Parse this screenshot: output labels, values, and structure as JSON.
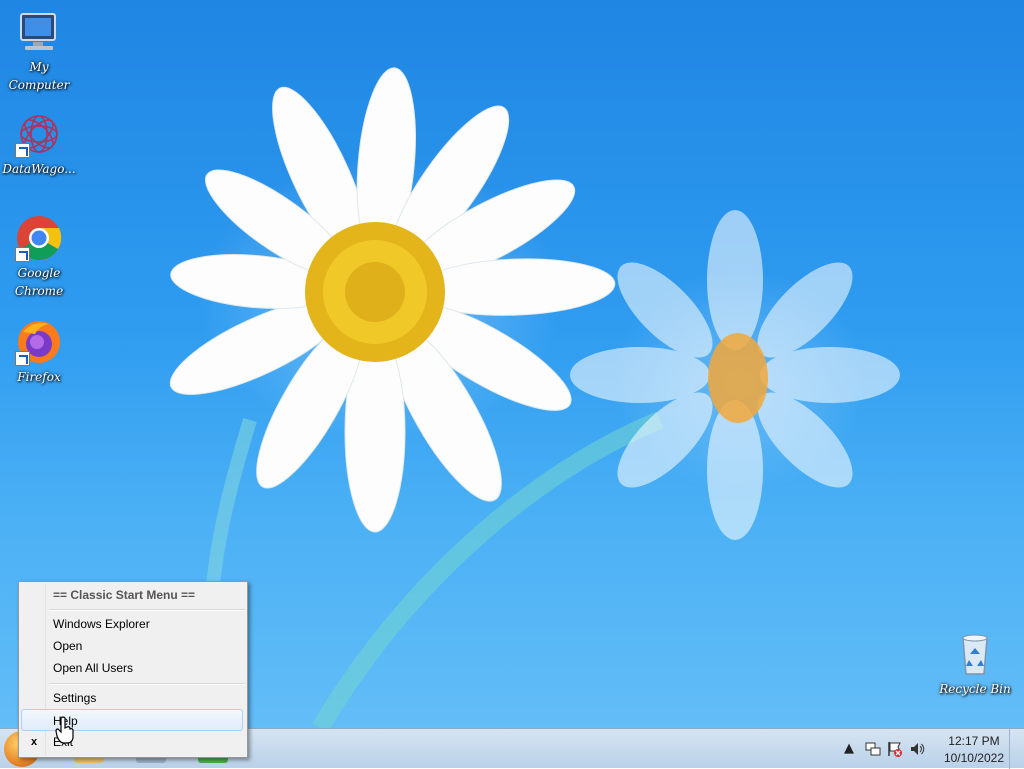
{
  "desktop": {
    "icons": [
      {
        "label": "My Computer",
        "icon": "computer-icon"
      },
      {
        "label": "DataWago...",
        "icon": "datawago-icon"
      },
      {
        "label": "Google Chrome",
        "icon": "chrome-icon"
      },
      {
        "label": "Firefox",
        "icon": "firefox-icon"
      },
      {
        "label": "Recycle Bin",
        "icon": "recycle-bin-icon"
      }
    ]
  },
  "context_menu": {
    "header": "== Classic Start Menu ==",
    "items": [
      {
        "label": "Windows Explorer"
      },
      {
        "label": "Open"
      },
      {
        "label": "Open All Users"
      },
      {
        "label": "Settings"
      },
      {
        "label": "Help"
      },
      {
        "label": "Exit",
        "mark": "x"
      }
    ],
    "highlighted": "Help"
  },
  "taskbar": {
    "clock": {
      "time": "12:17 PM",
      "date": "10/10/2022"
    },
    "tray_icons": [
      "show-hidden-icons-arrow",
      "network-icon",
      "action-center-flag-icon",
      "volume-icon"
    ]
  },
  "colors": {
    "sky_top": "#1f86e3",
    "sky_bottom": "#63bdf7",
    "menu_bg": "#f0f0f0",
    "highlight_border": "#aecff7"
  }
}
